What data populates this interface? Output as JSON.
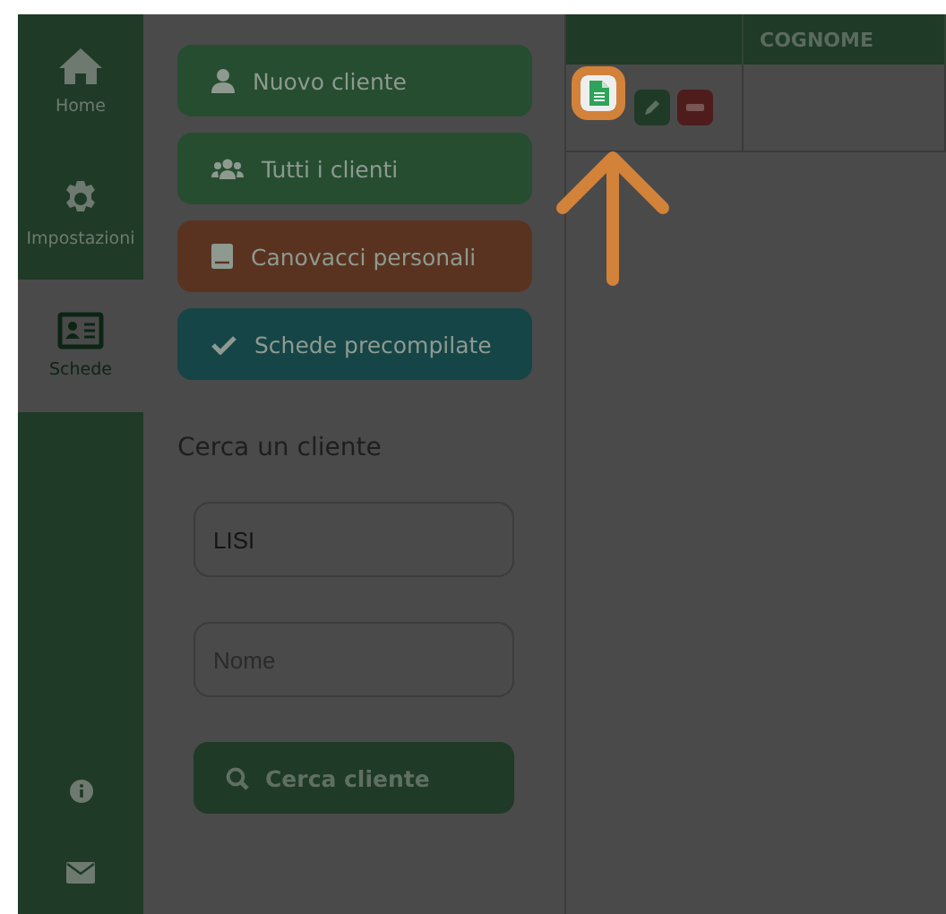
{
  "sidebar": {
    "items": [
      {
        "label": "Home",
        "kind": "home",
        "selected": false
      },
      {
        "label": "Impostazioni",
        "kind": "settings",
        "selected": false
      },
      {
        "label": "Schede",
        "kind": "card",
        "selected": true
      }
    ]
  },
  "menu_buttons": [
    {
      "label": "Nuovo cliente",
      "kind": "user",
      "color": "#264d30"
    },
    {
      "label": "Tutti i clienti",
      "kind": "users",
      "color": "#264d30"
    },
    {
      "label": "Canovacci personali",
      "kind": "book",
      "color": "#5a3320"
    },
    {
      "label": "Schede precompilate",
      "kind": "check",
      "color": "#154547"
    }
  ],
  "search": {
    "title": "Cerca un cliente",
    "surname": {
      "value": "LISI"
    },
    "name": {
      "placeholder": "Nome"
    },
    "button": "Cerca cliente"
  },
  "table": {
    "columns": [
      "COGNOME"
    ]
  }
}
